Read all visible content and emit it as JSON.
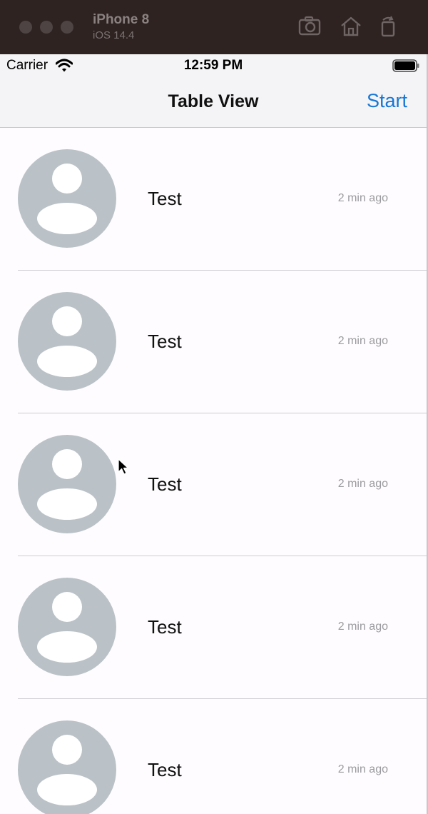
{
  "simulator": {
    "device_name": "iPhone 8",
    "os_version": "iOS 14.4"
  },
  "status_bar": {
    "carrier": "Carrier",
    "time": "12:59 PM"
  },
  "nav_bar": {
    "title": "Table View",
    "action_label": "Start"
  },
  "rows": [
    {
      "title": "Test",
      "time": "2 min ago"
    },
    {
      "title": "Test",
      "time": "2 min ago"
    },
    {
      "title": "Test",
      "time": "2 min ago"
    },
    {
      "title": "Test",
      "time": "2 min ago"
    },
    {
      "title": "Test",
      "time": "2 min ago"
    }
  ],
  "colors": {
    "accent": "#1677d6",
    "avatar_placeholder": "#bac2c8",
    "chrome_bar": "#2f2322"
  },
  "icons": [
    "screenshot-icon",
    "home-icon",
    "rotate-icon",
    "wifi-icon",
    "battery-icon",
    "person-placeholder-icon",
    "mouse-cursor-icon"
  ]
}
